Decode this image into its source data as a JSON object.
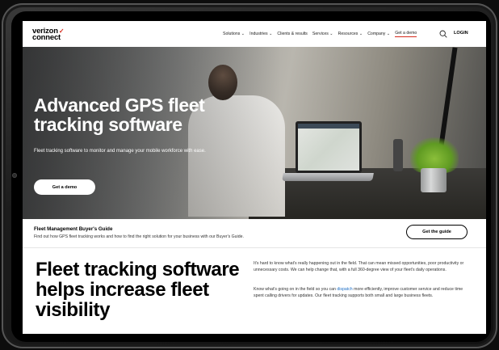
{
  "header": {
    "logo_line1": "verizon",
    "logo_check": "✓",
    "logo_line2": "connect",
    "nav": [
      {
        "label": "Solutions ⌄"
      },
      {
        "label": "Industries ⌄"
      },
      {
        "label": "Clients & results"
      },
      {
        "label": "Services ⌄"
      },
      {
        "label": "Resources ⌄"
      },
      {
        "label": "Company ⌄"
      },
      {
        "label": "Get a demo"
      }
    ],
    "login_label": "LOGIN",
    "search_icon": "search-icon"
  },
  "hero": {
    "title": "Advanced GPS fleet tracking software",
    "subtitle": "Fleet tracking software to monitor and manage your mobile workforce with ease.",
    "cta_label": "Get a demo"
  },
  "guide": {
    "title": "Fleet Management Buyer's Guide",
    "description": "Find out how GPS fleet tracking works and how to find the right solution for your business with our Buyer's Guide.",
    "cta_label": "Get the guide"
  },
  "section": {
    "title": "Fleet tracking software helps increase fleet visibility",
    "paragraph1": "It's hard to know what's really happening out in the field. That can mean missed opportunities, poor productivity or unnecessary costs. We can help change that, with a full 360-degree view of your fleet's daily operations.",
    "paragraph2_before": "Know what's going on in the field so you can ",
    "paragraph2_link": "dispatch",
    "paragraph2_after": " more efficiently, improve customer service and reduce time spent calling drivers for updates. Our fleet tracking supports both small and large business fleets."
  },
  "colors": {
    "brand_red": "#d52b1e",
    "link_blue": "#1f6fc5"
  }
}
